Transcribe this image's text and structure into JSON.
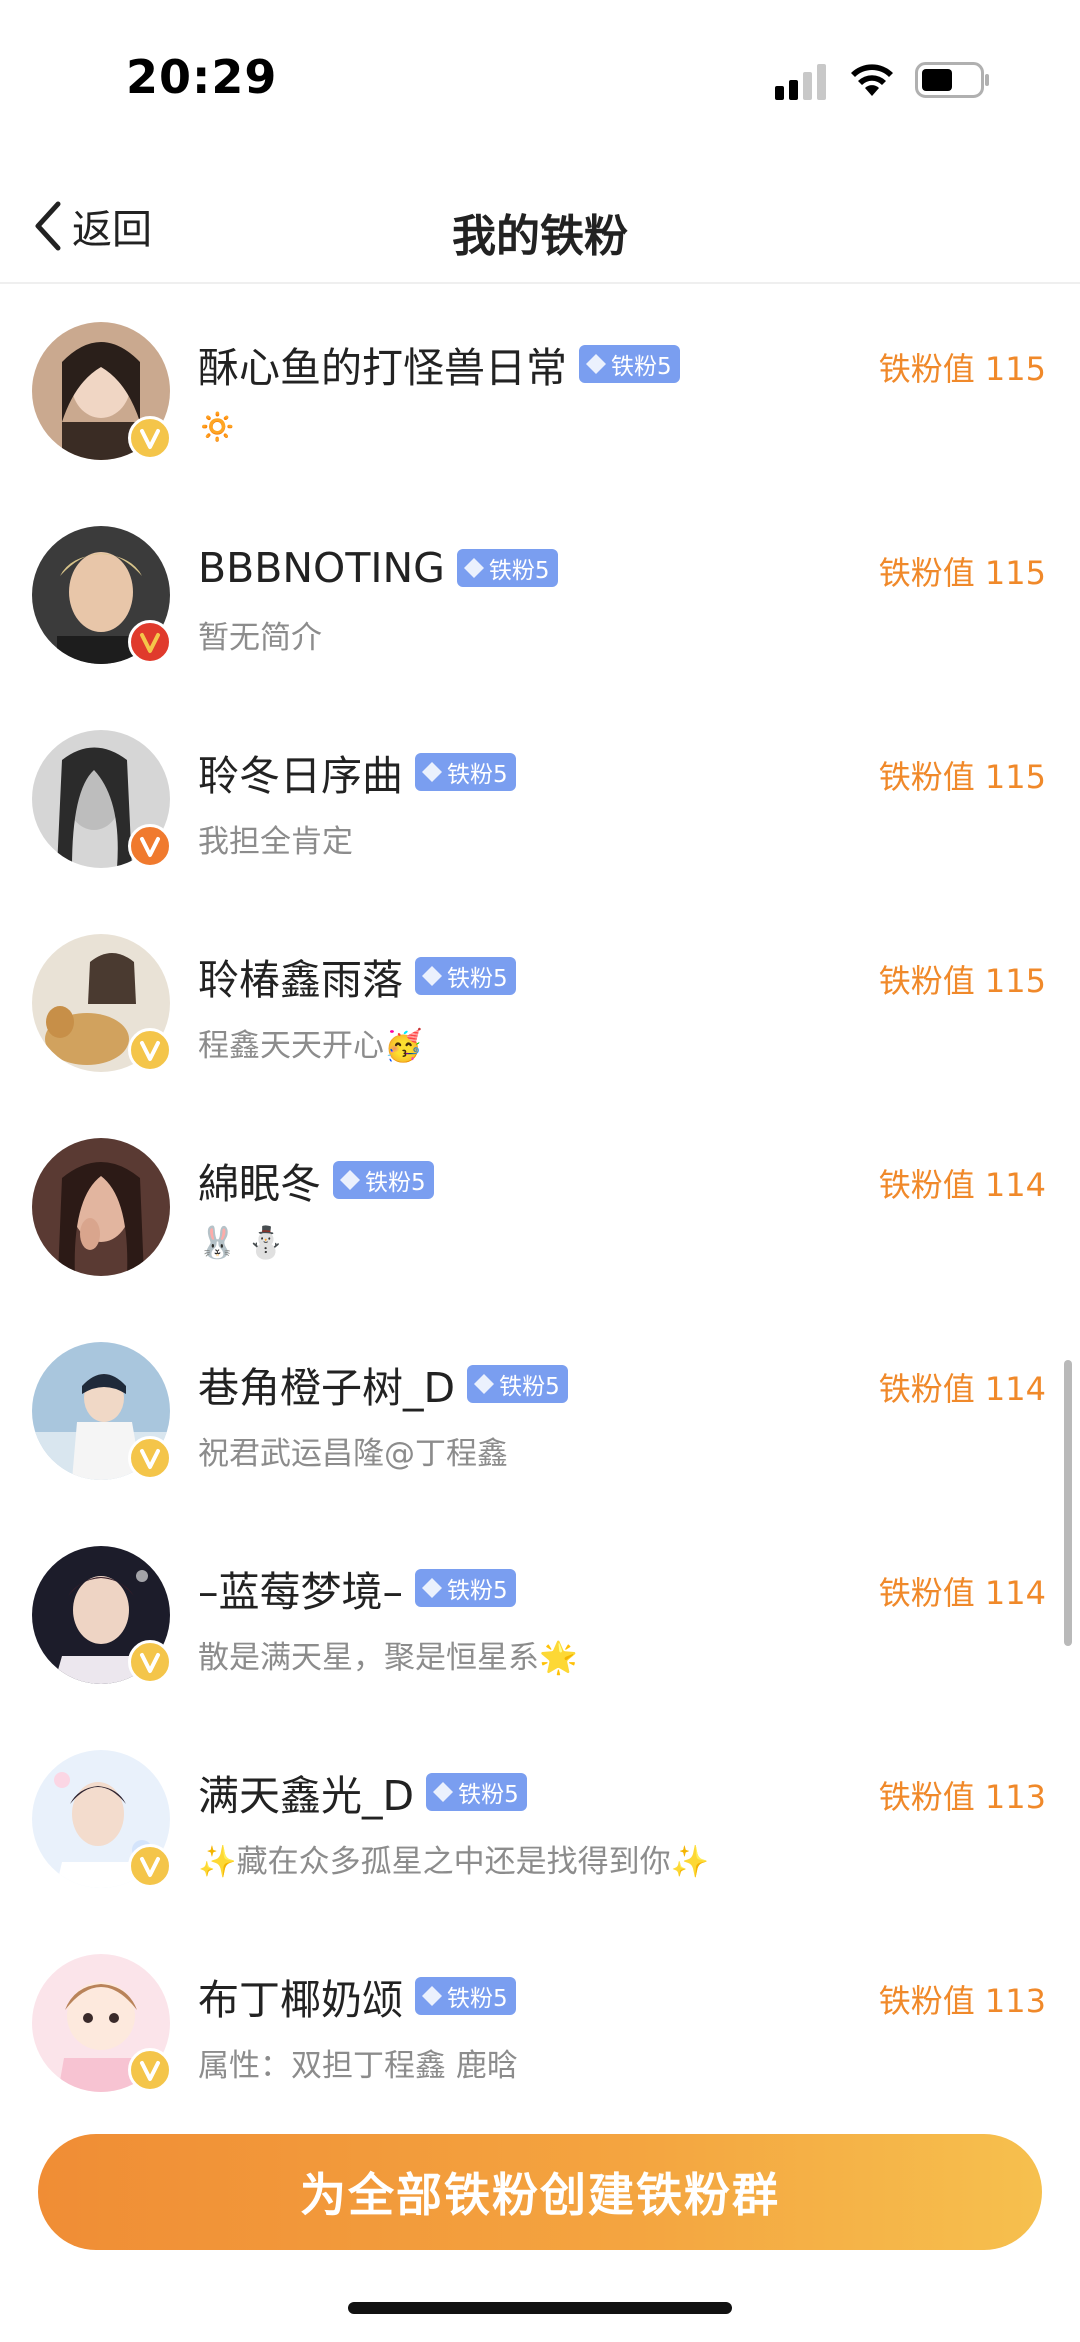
{
  "status_bar": {
    "time": "20:29"
  },
  "nav": {
    "back_label": "返回",
    "title": "我的铁粉"
  },
  "colors": {
    "accent": "#f0892a",
    "badge": "#7a9ef0",
    "v_gold": "#f4c54a",
    "v_red": "#e03a2c",
    "v_orange": "#f07a2e"
  },
  "fans": [
    {
      "name": "酥心鱼的打怪兽日常",
      "badge": "铁粉5",
      "bio": "🔅",
      "score": "铁粉值 115",
      "v": "gold"
    },
    {
      "name": "BBBNOTING",
      "badge": "铁粉5",
      "bio": "暂无简介",
      "score": "铁粉值 115",
      "v": "red"
    },
    {
      "name": "聆冬日序曲",
      "badge": "铁粉5",
      "bio": "我担全肯定",
      "score": "铁粉值 115",
      "v": "orange"
    },
    {
      "name": "聆椿鑫雨落",
      "badge": "铁粉5",
      "bio": "程鑫天天开心🥳",
      "score": "铁粉值 115",
      "v": "gold"
    },
    {
      "name": "綿眠冬",
      "badge": "铁粉5",
      "bio": "🐰 ⛄",
      "score": "铁粉值 114",
      "v": "none"
    },
    {
      "name": "巷角橙子树_D",
      "badge": "铁粉5",
      "bio": "祝君武运昌隆@丁程鑫",
      "score": "铁粉值 114",
      "v": "gold"
    },
    {
      "name": "–蓝莓梦境–",
      "badge": "铁粉5",
      "bio": "散是满天星，聚是恒星系🌟",
      "score": "铁粉值 114",
      "v": "gold"
    },
    {
      "name": "满天鑫光_D",
      "badge": "铁粉5",
      "bio": "✨藏在众多孤星之中还是找得到你✨",
      "score": "铁粉值 113",
      "v": "gold"
    },
    {
      "name": "布丁椰奶颂",
      "badge": "铁粉5",
      "bio": "属性：双担丁程鑫 鹿晗",
      "score": "铁粉值 113",
      "v": "gold"
    }
  ],
  "bottom": {
    "button_label": "为全部铁粉创建铁粉群"
  }
}
